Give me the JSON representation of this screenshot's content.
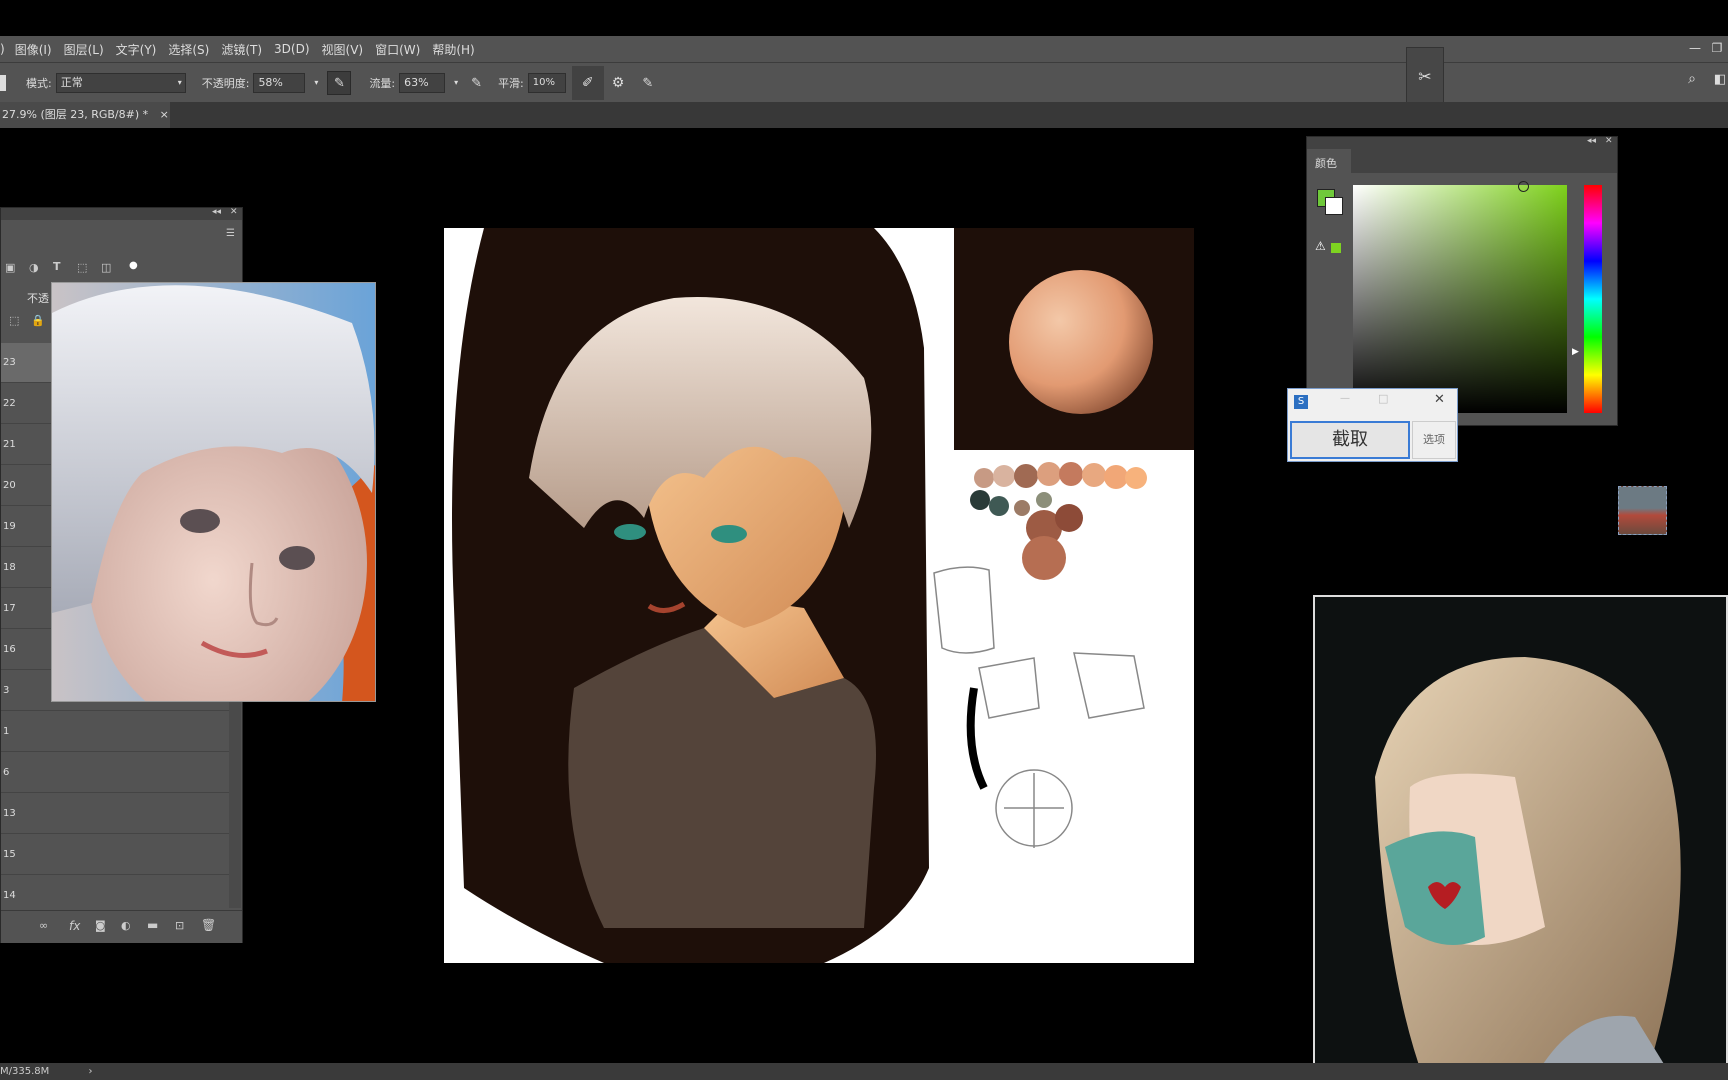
{
  "menu": [
    "图像(I)",
    "图层(L)",
    "文字(Y)",
    "选择(S)",
    "滤镜(T)",
    "3D(D)",
    "视图(V)",
    "窗口(W)",
    "帮助(H)"
  ],
  "menu_prefix": ")",
  "options": {
    "mode_label": "模式:",
    "mode_value": "正常",
    "opacity_label": "不透明度:",
    "opacity_value": "58%",
    "flow_label": "流量:",
    "flow_value": "63%",
    "smoothing_label": "平滑:",
    "smoothing_value": "10%"
  },
  "document_tab": {
    "title": "27.9% (图层 23, RGB/8#) *",
    "close": "×"
  },
  "layers_panel": {
    "opacity_label": "不透",
    "layers": [
      "23",
      "22",
      "21",
      "20",
      "19",
      "18",
      "17",
      "16",
      "3",
      "1",
      "6",
      "13",
      "15",
      "14"
    ],
    "fx_label": "fx"
  },
  "color_panel": {
    "title": "颜色",
    "foreground": "#6fc93a",
    "background": "#ffffff",
    "picker_hue": "#7ed11b"
  },
  "snipping_tool": {
    "crop_button": "截取",
    "options_button": "选项",
    "close": "✕",
    "minimize": "—",
    "maximize": "□"
  },
  "status": {
    "doc_size": "M/335.8M"
  }
}
